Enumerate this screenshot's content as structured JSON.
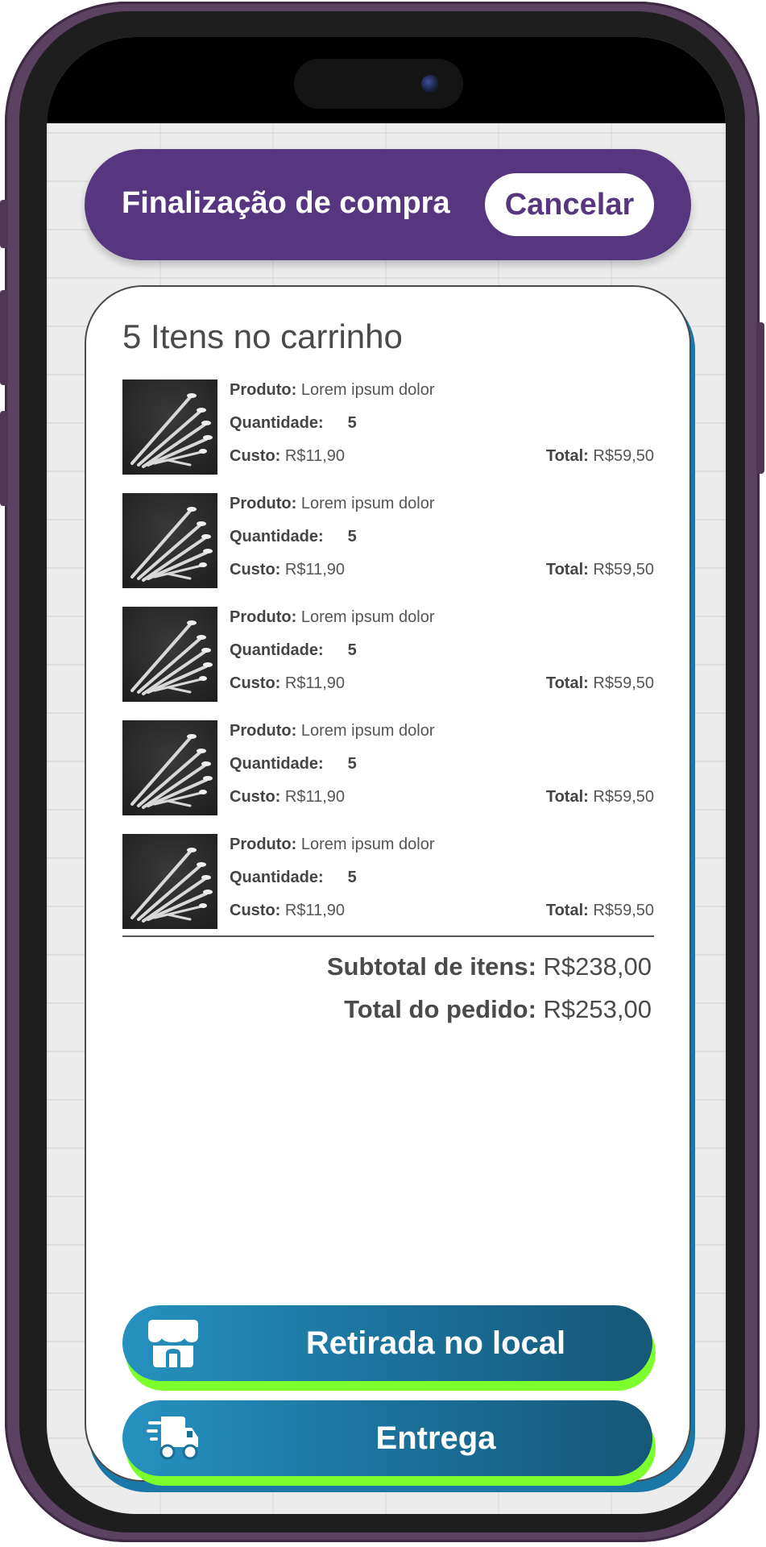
{
  "header": {
    "title": "Finalização de compra",
    "cancel_label": "Cancelar"
  },
  "cart": {
    "title": "5 Itens no carrinho",
    "labels": {
      "product": "Produto:",
      "quantity": "Quantidade:",
      "cost": "Custo:",
      "total": "Total:"
    },
    "items": [
      {
        "product": "Lorem ipsum dolor",
        "quantity": "5",
        "cost": "R$11,90",
        "total": "R$59,50"
      },
      {
        "product": "Lorem ipsum dolor",
        "quantity": "5",
        "cost": "R$11,90",
        "total": "R$59,50"
      },
      {
        "product": "Lorem ipsum dolor",
        "quantity": "5",
        "cost": "R$11,90",
        "total": "R$59,50"
      },
      {
        "product": "Lorem ipsum dolor",
        "quantity": "5",
        "cost": "R$11,90",
        "total": "R$59,50"
      },
      {
        "product": "Lorem ipsum dolor",
        "quantity": "5",
        "cost": "R$11,90",
        "total": "R$59,50"
      }
    ]
  },
  "summary": {
    "subtotal_label": "Subtotal de itens:",
    "subtotal_value": "R$238,00",
    "order_total_label": "Total do pedido:",
    "order_total_value": "R$253,00"
  },
  "actions": {
    "pickup_label": "Retirada no local",
    "pickup_icon": "storefront-icon",
    "delivery_label": "Entrega",
    "delivery_icon": "delivery-truck-icon"
  },
  "colors": {
    "header_bg": "#56367f",
    "button_gradient_start": "#2691c0",
    "button_gradient_end": "#155878",
    "button_accent": "#7dff2e",
    "card_shadow": "#1c77a9"
  }
}
